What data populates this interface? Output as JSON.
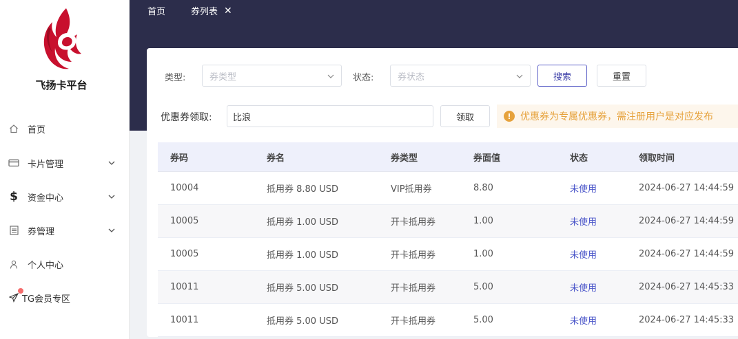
{
  "brand": {
    "name": "飞扬卡平台"
  },
  "colors": {
    "header_bg": "#2c2d4b",
    "accent": "#4a55c9",
    "warning": "#e6a23c",
    "logo_red": "#c8102e"
  },
  "sidebar": {
    "items": [
      {
        "label": "首页",
        "icon": "home-icon",
        "has_children": false
      },
      {
        "label": "卡片管理",
        "icon": "card-icon",
        "has_children": true
      },
      {
        "label": "资金中心",
        "icon": "dollar-icon",
        "has_children": true
      },
      {
        "label": "券管理",
        "icon": "document-icon",
        "has_children": true
      },
      {
        "label": "个人中心",
        "icon": "user-icon",
        "has_children": false
      },
      {
        "label": "TG会员专区",
        "icon": "paper-plane-icon",
        "has_children": false,
        "badge_dot": true
      }
    ]
  },
  "tabs": [
    {
      "label": "首页",
      "closable": false
    },
    {
      "label": "券列表",
      "closable": true,
      "close_glyph": "✕"
    }
  ],
  "filters": {
    "type_label": "类型:",
    "type_placeholder": "券类型",
    "status_label": "状态:",
    "status_placeholder": "券状态",
    "search_label": "搜索",
    "reset_label": "重置"
  },
  "claim": {
    "label": "优惠券领取:",
    "value": "比浪",
    "button_label": "领取"
  },
  "notice": {
    "text": "优惠券为专属优惠券，需注册用户是对应发布"
  },
  "table": {
    "columns": [
      "券码",
      "券名",
      "券类型",
      "券面值",
      "状态",
      "领取时间"
    ],
    "rows": [
      [
        "10004",
        "抵用券 8.80 USD",
        "VIP抵用券",
        "8.80",
        "未使用",
        "2024-06-27 14:44:59"
      ],
      [
        "10005",
        "抵用券 1.00 USD",
        "开卡抵用券",
        "1.00",
        "未使用",
        "2024-06-27 14:44:59"
      ],
      [
        "10005",
        "抵用券 1.00 USD",
        "开卡抵用券",
        "1.00",
        "未使用",
        "2024-06-27 14:44:59"
      ],
      [
        "10011",
        "抵用券 5.00 USD",
        "开卡抵用券",
        "5.00",
        "未使用",
        "2024-06-27 14:45:33"
      ],
      [
        "10011",
        "抵用券 5.00 USD",
        "开卡抵用券",
        "5.00",
        "未使用",
        "2024-06-27 14:45:33"
      ]
    ]
  }
}
